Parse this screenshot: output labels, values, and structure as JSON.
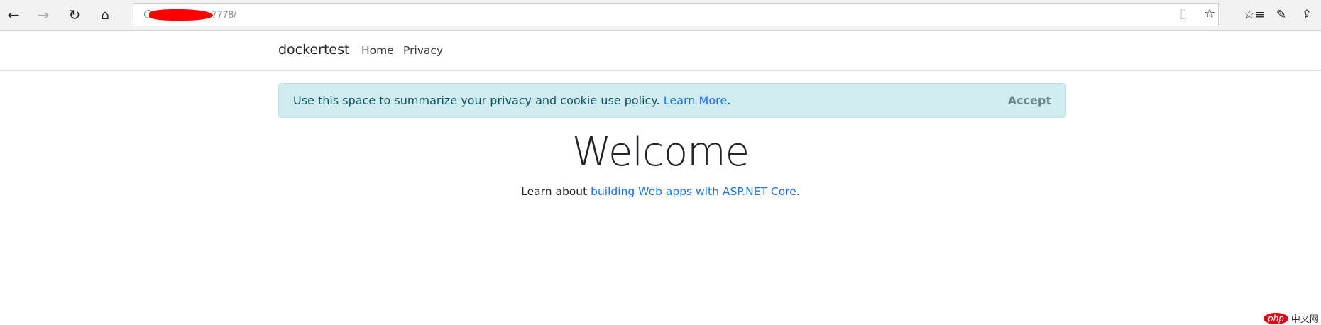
{
  "browser": {
    "url": "7778/",
    "icons": [
      "back-icon",
      "forward-icon",
      "refresh-icon",
      "home-icon",
      "reading-view-icon",
      "favorite-star-icon",
      "favorites-list-icon",
      "pen-icon",
      "share-icon"
    ]
  },
  "navbar": {
    "brand": "dockertest",
    "links": [
      "Home",
      "Privacy"
    ]
  },
  "cookie_alert": {
    "message": "Use this space to summarize your privacy and cookie use policy.",
    "link": "Learn More",
    "period": ".",
    "accept": "Accept",
    "colors": {
      "background": "#d1ecf1",
      "text": "#0c5460"
    }
  },
  "main": {
    "title": "Welcome",
    "learn_prefix": "Learn about",
    "learn_link": "building Web apps with ASP.NET Core",
    "learn_suffix": "."
  },
  "watermark": {
    "logo": "php",
    "text": "中文网"
  }
}
